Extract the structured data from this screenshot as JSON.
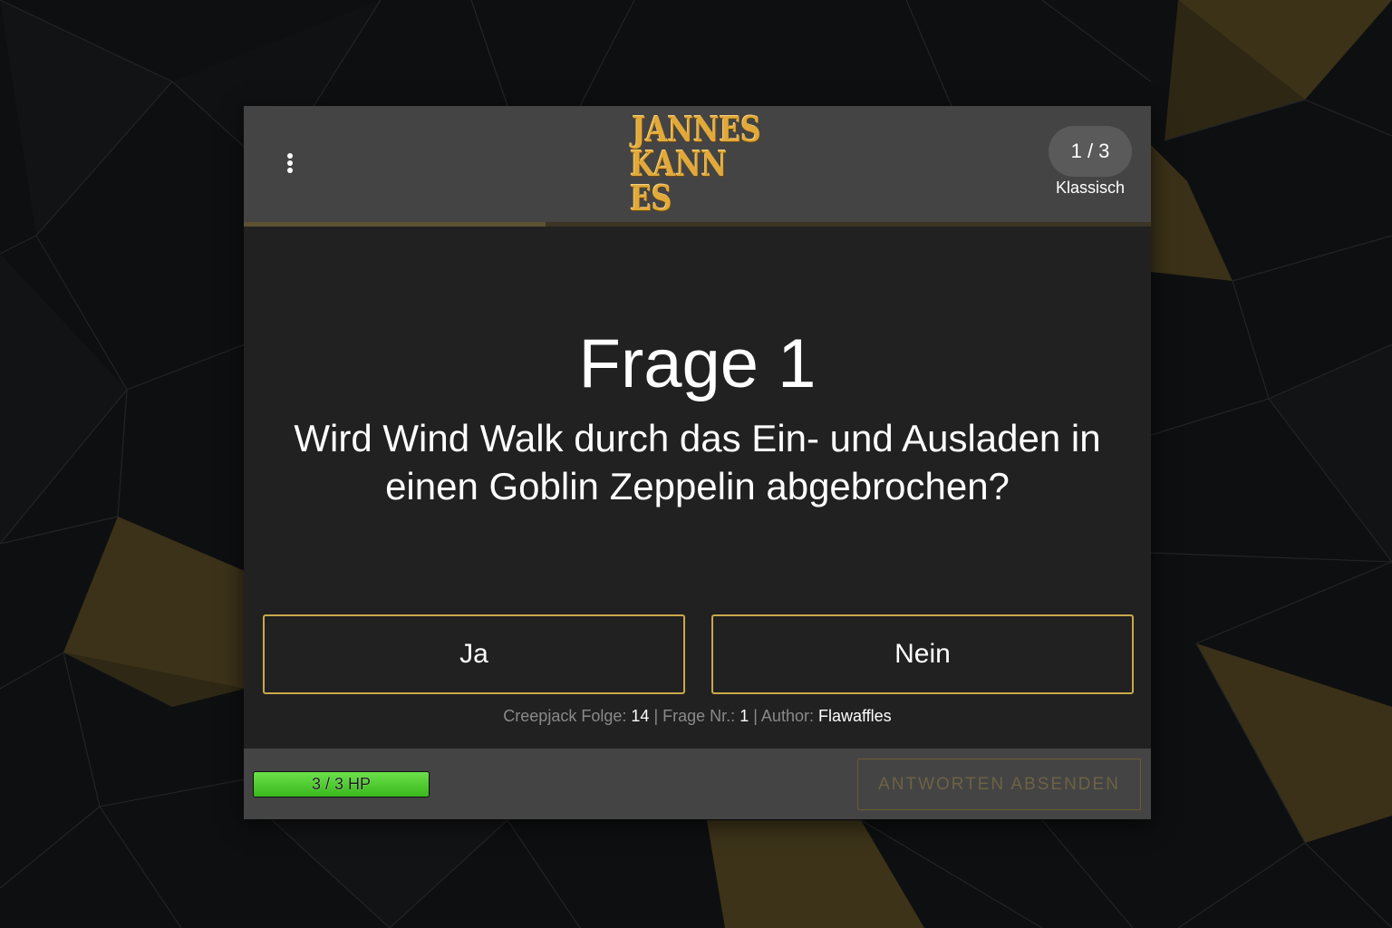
{
  "app": {
    "logo_line1": "JANNES",
    "logo_line2": "KANN ES"
  },
  "header": {
    "menu_icon": "more-vertical-icon",
    "round_counter": "1 / 3",
    "mode": "Klassisch",
    "progress_fraction": 0.333
  },
  "question": {
    "number_label": "Frage 1",
    "text": "Wird Wind Walk durch das Ein- und Ausladen in einen Goblin Zeppelin abgebrochen?"
  },
  "answers": [
    {
      "label": "Ja"
    },
    {
      "label": "Nein"
    }
  ],
  "meta": {
    "episode_label": "Creepjack Folge:",
    "episode_value": "14",
    "separator": "|",
    "question_no_label": "Frage Nr.:",
    "question_no_value": "1",
    "author_label": "Author:",
    "author_value": "Flawaffles"
  },
  "footer": {
    "hp_text": "3 / 3 HP",
    "hp_fraction": 1.0,
    "submit_label": "ANTWORTEN ABSENDEN"
  },
  "colors": {
    "accent_gold": "#c9a84a",
    "card_bg": "#212121",
    "header_bg": "#444444",
    "hp_green": "#4cc92d",
    "page_bg": "#0d0e0f"
  }
}
